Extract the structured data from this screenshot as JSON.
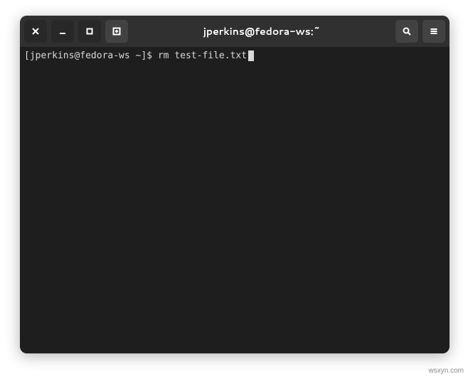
{
  "window": {
    "title": "jperkins@fedora-ws:~"
  },
  "terminal": {
    "prompt": "[jperkins@fedora-ws ~]$ ",
    "command": "rm test-file.txt"
  },
  "watermark": "wsxyn.com"
}
